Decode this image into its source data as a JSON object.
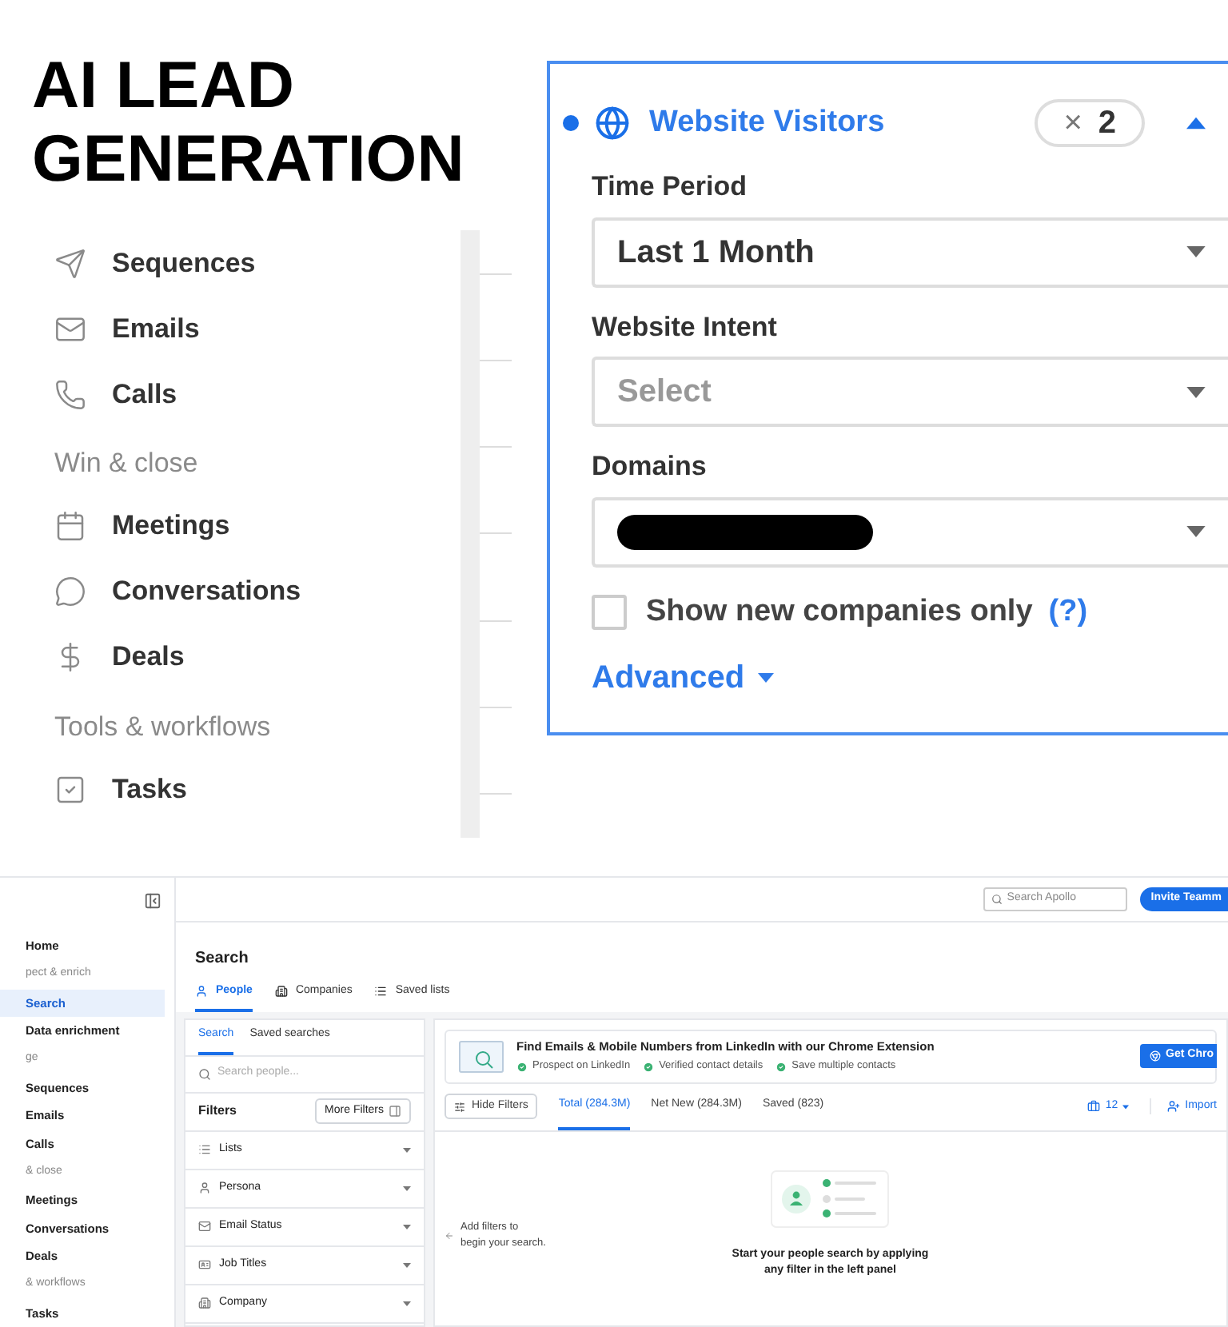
{
  "headline": [
    "AI LEAD",
    "GENERATION"
  ],
  "nav_crop": {
    "items": [
      {
        "kind": "item",
        "label": "Sequences"
      },
      {
        "kind": "item",
        "label": "Emails"
      },
      {
        "kind": "item",
        "label": "Calls"
      },
      {
        "kind": "header",
        "label": "Win & close"
      },
      {
        "kind": "item",
        "label": "Meetings"
      },
      {
        "kind": "item",
        "label": "Conversations"
      },
      {
        "kind": "item",
        "label": "Deals"
      },
      {
        "kind": "header",
        "label": "Tools & workflows"
      },
      {
        "kind": "item",
        "label": "Tasks"
      }
    ]
  },
  "filter_panel": {
    "title": "Website Visitors",
    "active": true,
    "count_chip": {
      "icon": "×",
      "count": "2"
    },
    "expanded": true,
    "fields": [
      {
        "label": "Time Period",
        "value": "Last 1 Month",
        "kind": "value"
      },
      {
        "label": "Website Intent",
        "placeholder": "Select",
        "kind": "placeholder"
      },
      {
        "label": "Domains",
        "kind": "redacted"
      }
    ],
    "checkbox": {
      "label": "Show new companies only",
      "help": "(?)",
      "checked": false
    },
    "advanced": "Advanced"
  },
  "app": {
    "top_bar": {
      "search_placeholder": "Search Apollo",
      "invite_button": "Invite Teamm"
    },
    "sidebar": {
      "items": [
        {
          "kind": "item",
          "label": "Home",
          "selected": false
        },
        {
          "kind": "header",
          "label": "pect & enrich"
        },
        {
          "kind": "item",
          "label": "Search",
          "selected": true
        },
        {
          "kind": "item",
          "label": "Data enrichment",
          "selected": false
        },
        {
          "kind": "header",
          "label": "ge"
        },
        {
          "kind": "item",
          "label": "Sequences",
          "selected": false
        },
        {
          "kind": "item",
          "label": "Emails",
          "selected": false
        },
        {
          "kind": "item",
          "label": "Calls",
          "selected": false
        },
        {
          "kind": "header",
          "label": "& close"
        },
        {
          "kind": "item",
          "label": "Meetings",
          "selected": false
        },
        {
          "kind": "item",
          "label": "Conversations",
          "selected": false
        },
        {
          "kind": "item",
          "label": "Deals",
          "selected": false
        },
        {
          "kind": "header",
          "label": "& workflows"
        },
        {
          "kind": "item",
          "label": "Tasks",
          "selected": false
        }
      ]
    },
    "page_title": "Search",
    "tabs": [
      {
        "label": "People",
        "selected": true
      },
      {
        "label": "Companies",
        "selected": false
      },
      {
        "label": "Saved lists",
        "selected": false
      }
    ],
    "filter_tabs": [
      {
        "label": "Search",
        "selected": true
      },
      {
        "label": "Saved searches",
        "selected": false
      }
    ],
    "search_placeholder": "Search people...",
    "filters_heading": "Filters",
    "more_filters": "More Filters",
    "filters": [
      {
        "label": "Lists"
      },
      {
        "label": "Persona"
      },
      {
        "label": "Email Status"
      },
      {
        "label": "Job Titles"
      },
      {
        "label": "Company"
      }
    ],
    "banner": {
      "title": "Find Emails & Mobile Numbers from LinkedIn with our Chrome Extension",
      "points": [
        "Prospect on LinkedIn",
        "Verified contact details",
        "Save multiple contacts"
      ],
      "button": "Get Chro"
    },
    "hide_filters": "Hide Filters",
    "result_tabs": [
      {
        "label": "Total (284.3M)",
        "selected": true
      },
      {
        "label": "Net New (284.3M)",
        "selected": false
      },
      {
        "label": "Saved (823)",
        "selected": false
      }
    ],
    "per_page": "12",
    "import": "Import",
    "hint": [
      "Add filters to",
      "begin your search."
    ],
    "empty_message": [
      "Start your people search by applying",
      "any filter in the left panel"
    ]
  }
}
